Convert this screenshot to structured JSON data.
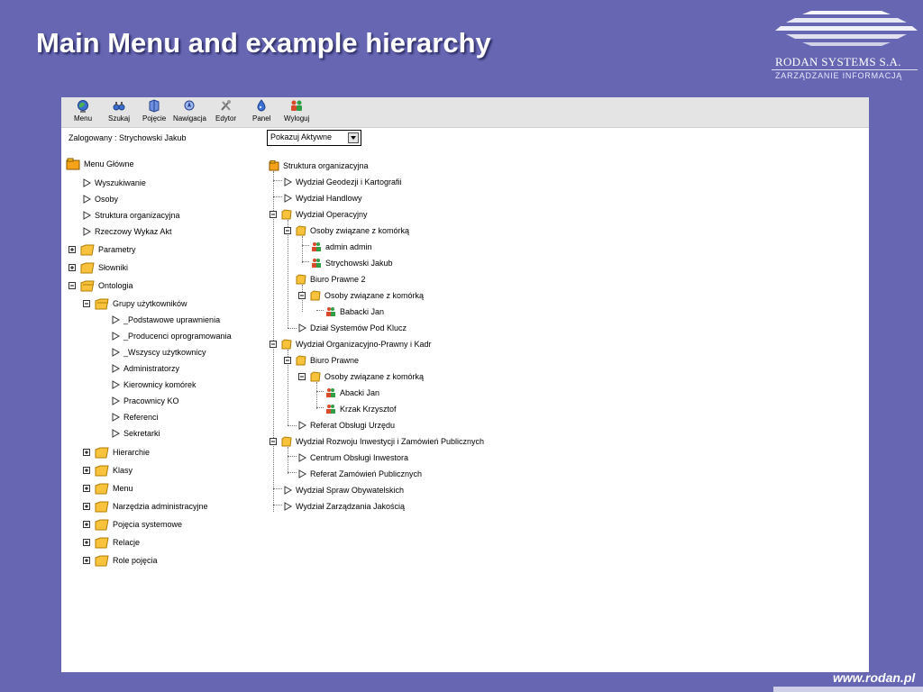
{
  "slide": {
    "title": "Main Menu and example hierarchy",
    "company": "RODAN SYSTEMS S.A.",
    "tagline": "ZARZĄDZANIE INFORMACJĄ",
    "url": "www.rodan.pl"
  },
  "toolbar": [
    {
      "label": "Menu",
      "icon": "globe-icon"
    },
    {
      "label": "Szukaj",
      "icon": "binoculars-icon"
    },
    {
      "label": "Pojęcie",
      "icon": "concept-icon"
    },
    {
      "label": "Nawigacja",
      "icon": "navigation-icon"
    },
    {
      "label": "Edytor",
      "icon": "tools-icon"
    },
    {
      "label": "Panel",
      "icon": "panel-icon"
    },
    {
      "label": "Wyloguj",
      "icon": "logout-icon"
    }
  ],
  "session": {
    "logged_in": "Zalogowany :  Strychowski Jakub"
  },
  "filter": {
    "selected": "Pokazuj Aktywne"
  },
  "menu": {
    "root": "Menu Główne",
    "items": [
      "Wyszukiwanie",
      "Osoby",
      "Struktura organizacyjna",
      "Rzeczowy Wykaz Akt"
    ],
    "parametry": "Parametry",
    "slowniki": "Słowniki",
    "ontologia": "Ontologia",
    "grupy": "Grupy użytkowników",
    "groups": [
      "_Podstawowe uprawnienia",
      "_Producenci oprogramowania",
      "_Wszyscy użytkownicy",
      "Administratorzy",
      "Kierownicy komórek",
      "Pracownicy KO",
      "Referenci",
      "Sekretarki"
    ],
    "sub": [
      "Hierarchie",
      "Klasy",
      "Menu",
      "Narzędzia administracyjne",
      "Pojęcia systemowe",
      "Relacje",
      "Role pojęcia"
    ]
  },
  "tree": {
    "root": "Struktura organizacyjna",
    "n1": "Wydział Geodezji i Kartografii",
    "n2": "Wydział Handlowy",
    "n3": "Wydział Operacyjny",
    "n3_osoby": "Osoby związane z komórką",
    "n3_p1": "admin admin",
    "n3_p2": "Strychowski Jakub",
    "n3_biuro": "Biuro Prawne 2",
    "n3_biuro_osoby": "Osoby związane z komórką",
    "n3_biuro_p1": "Babacki Jan",
    "n3_dzial": "Dział Systemów Pod Klucz",
    "n4": "Wydział Organizacyjno-Prawny i Kadr",
    "n4_biuro": "Biuro Prawne",
    "n4_osoby": "Osoby związane z komórką",
    "n4_p1": "Abacki Jan",
    "n4_p2": "Krzak Krzysztof",
    "n4_ref": "Referat Obsługi Urzędu",
    "n5": "Wydział Rozwoju Inwestycji i Zamówień Publicznych",
    "n5_c1": "Centrum Obsługi Inwestora",
    "n5_c2": "Referat Zamówień Publicznych",
    "n6": "Wydział Spraw Obywatelskich",
    "n7": "Wydział Zarządzania Jakością"
  }
}
